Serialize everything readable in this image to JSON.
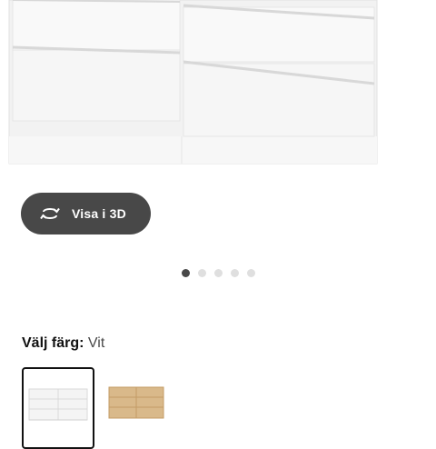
{
  "product_image": {
    "alt_icon": "white-dresser-image"
  },
  "view_3d": {
    "label": "Visa i 3D",
    "icon": "rotate-3d-icon"
  },
  "carousel": {
    "total": 5,
    "active_index": 0
  },
  "color_picker": {
    "key_label": "Välj färg:",
    "selected_value": "Vit",
    "options": [
      {
        "name": "white",
        "swatch_color": "#f4f4f4",
        "selected": true
      },
      {
        "name": "oak",
        "swatch_color": "#d9b98a",
        "selected": false
      }
    ]
  },
  "colors": {
    "button_bg": "#484848",
    "active_dot": "#484848",
    "inactive_dot": "#dfdfdf"
  }
}
